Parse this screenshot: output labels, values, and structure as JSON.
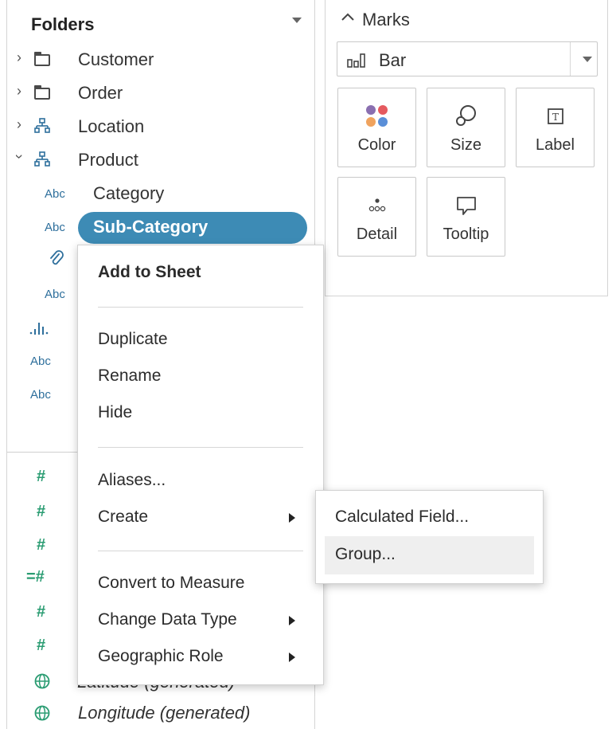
{
  "data_pane": {
    "header": "Folders",
    "folders": [
      {
        "label": "Customer",
        "icon": "folder-icon",
        "expanded": false
      },
      {
        "label": "Order",
        "icon": "folder-icon",
        "expanded": false
      },
      {
        "label": "Location",
        "icon": "hierarchy-icon",
        "expanded": false
      },
      {
        "label": "Product",
        "icon": "hierarchy-icon",
        "expanded": true
      }
    ],
    "product_fields": [
      {
        "type": "Abc",
        "label": "Category"
      },
      {
        "type": "Abc",
        "label": "Sub-Category",
        "selected": true
      }
    ],
    "hidden_field_types": [
      "Abc",
      "Abc",
      "Abc"
    ],
    "measures_bottom": [
      {
        "icon": "globe-icon",
        "label": "Latitude (generated)"
      },
      {
        "icon": "globe-icon",
        "label": "Longitude (generated)"
      }
    ]
  },
  "marks": {
    "title": "Marks",
    "mark_type": "Bar",
    "buttons": [
      {
        "label": "Color",
        "icon": "color-icon"
      },
      {
        "label": "Size",
        "icon": "size-icon"
      },
      {
        "label": "Label",
        "icon": "label-icon"
      },
      {
        "label": "Detail",
        "icon": "detail-icon"
      },
      {
        "label": "Tooltip",
        "icon": "tooltip-icon"
      }
    ]
  },
  "context_menu": {
    "items": [
      {
        "label": "Add to Sheet",
        "bold": true
      },
      {
        "label": "Duplicate"
      },
      {
        "label": "Rename"
      },
      {
        "label": "Hide"
      },
      {
        "label": "Aliases..."
      },
      {
        "label": "Create",
        "submenu": true
      },
      {
        "label": "Convert to Measure"
      },
      {
        "label": "Change Data Type",
        "submenu": true
      },
      {
        "label": "Geographic Role",
        "submenu": true
      }
    ]
  },
  "create_submenu": {
    "items": [
      {
        "label": "Calculated Field..."
      },
      {
        "label": "Group...",
        "highlighted": true
      }
    ]
  },
  "colors": {
    "selection": "#3d8bb5",
    "dimension_blue": "#2e6f9c",
    "measure_green": "#2a9c72"
  }
}
